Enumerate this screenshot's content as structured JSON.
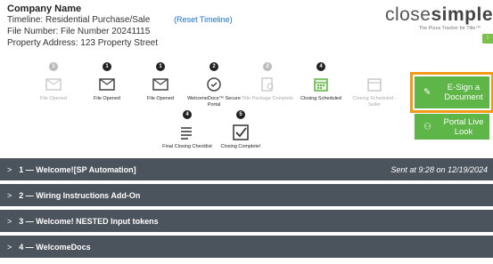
{
  "header": {
    "company": "Company Name",
    "timeline_label": "Timeline:",
    "timeline_value": "Residential Purchase/Sale",
    "reset_link": "(Reset Timeline)",
    "file_label": "File Number:",
    "file_value": "File Number 20241115",
    "address_label": "Property Address:",
    "address_value": "123 Property Street"
  },
  "brand": {
    "name_light": "close",
    "name_bold": "simple",
    "tagline": "The Pizza Tracker for Title™",
    "badge": "i"
  },
  "steps": [
    {
      "num": "1",
      "label": "File Opened",
      "dim": true
    },
    {
      "num": "1",
      "label": "File Opened",
      "dim": false
    },
    {
      "num": "1",
      "label": "File Opened",
      "dim": false
    },
    {
      "num": "2",
      "label": "WelcomeDocs™ Secure Portal",
      "dim": false
    },
    {
      "num": "2",
      "label": "Title Package Complete",
      "dim": true
    },
    {
      "num": "4",
      "label": "Closing Scheduled",
      "dim": false
    },
    {
      "num": "",
      "label": "Closing Scheduled - Seller",
      "dim": true
    }
  ],
  "steps_row2": [
    {
      "num": "4",
      "label": "Final Closing Checklist"
    },
    {
      "num": "5",
      "label": "Closing Complete!"
    }
  ],
  "actions": {
    "esign": "E-Sign a Document",
    "portal": "Portal Live Look"
  },
  "accordion": [
    {
      "title": "1 — Welcome![SP Automation]",
      "sent": "Sent at 9:28 on 12/19/2024"
    },
    {
      "title": "2 — Wiring Instructions Add-On",
      "sent": ""
    },
    {
      "title": "3 — Welcome! NESTED Input tokens",
      "sent": ""
    },
    {
      "title": "4 — WelcomeDocs",
      "sent": ""
    }
  ],
  "colors": {
    "accent_green": "#5eb548",
    "highlight_orange": "#f29a18",
    "accordion_bg": "#4b535d",
    "link_blue": "#1a6fd0"
  }
}
